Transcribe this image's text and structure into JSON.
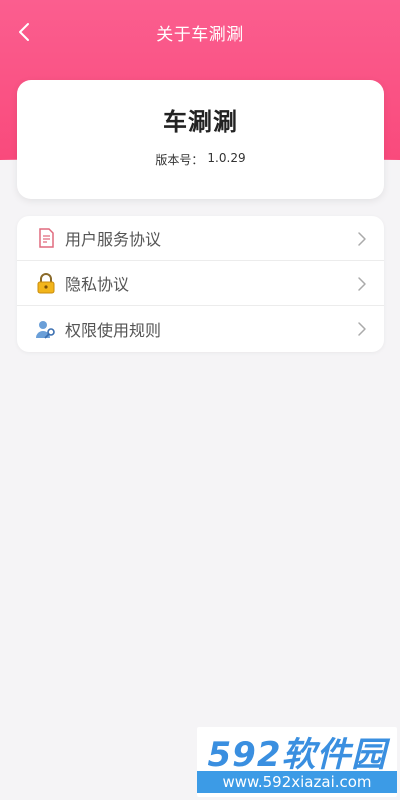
{
  "header": {
    "title": "关于车涮涮",
    "back_icon": "chevron-left-icon",
    "background_color": "#fb5e8f"
  },
  "app_info": {
    "name": "车涮涮",
    "version_label": "版本号：",
    "version": "1.0.29"
  },
  "menu": {
    "items": [
      {
        "label": "用户服务协议",
        "icon": "document-icon"
      },
      {
        "label": "隐私协议",
        "icon": "lock-icon"
      },
      {
        "label": "权限使用规则",
        "icon": "user-key-icon"
      }
    ]
  },
  "watermark": {
    "brand": "592软件园",
    "url": "www.592xiazai.com"
  }
}
